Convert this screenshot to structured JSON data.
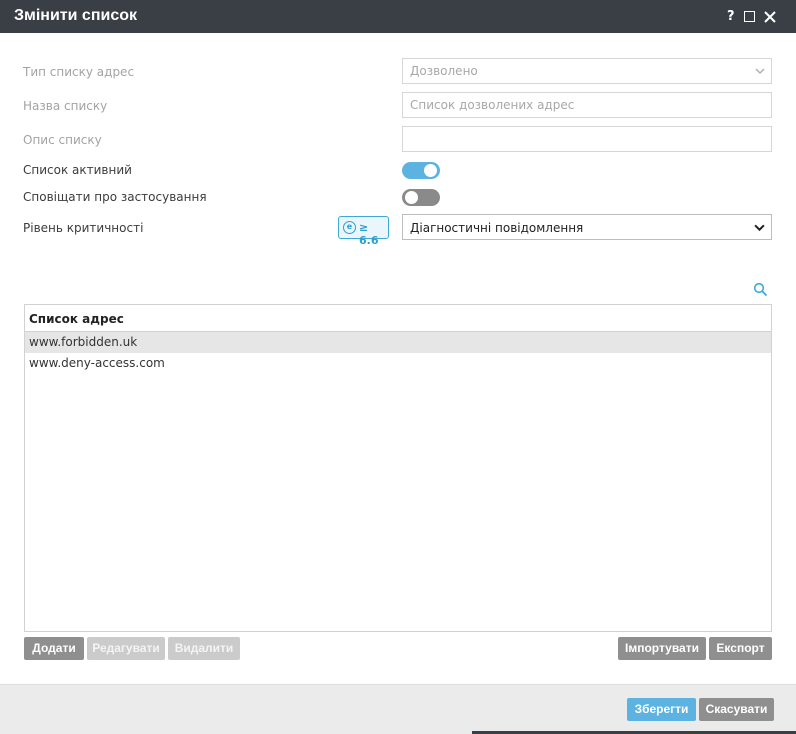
{
  "window": {
    "title": "Змінити список",
    "help_label": "?"
  },
  "form": {
    "list_type": {
      "label": "Тип списку адрес",
      "value": "Дозволено"
    },
    "list_name": {
      "label": "Назва списку",
      "placeholder": "Список дозволених адрес"
    },
    "list_description": {
      "label": "Опис списку",
      "value": ""
    },
    "list_active": {
      "label": "Список активний",
      "enabled": true
    },
    "notify_on_apply": {
      "label": "Сповіщати про застосування",
      "enabled": false
    },
    "severity": {
      "label": "Рівень критичності",
      "version_badge": "≥ 6.6",
      "value": "Діагностичні повідомлення"
    }
  },
  "table": {
    "header": "Список адрес",
    "rows": [
      {
        "address": "www.forbidden.uk",
        "selected": true
      },
      {
        "address": "www.deny-access.com",
        "selected": false
      }
    ]
  },
  "actions": {
    "add": "Додати",
    "edit": "Редагувати",
    "delete": "Видалити",
    "import": "Імпортувати",
    "export": "Експорт"
  },
  "footer": {
    "save": "Зберегти",
    "cancel": "Скасувати"
  },
  "colors": {
    "titlebar": "#3a3f46",
    "accent": "#5cb3e2",
    "button_gray": "#8f8f8f",
    "button_disabled": "#cbcbcb"
  },
  "icons": [
    "help-icon",
    "maximize-icon",
    "close-icon",
    "chevron-down-icon",
    "eset-e-icon",
    "search-icon"
  ]
}
